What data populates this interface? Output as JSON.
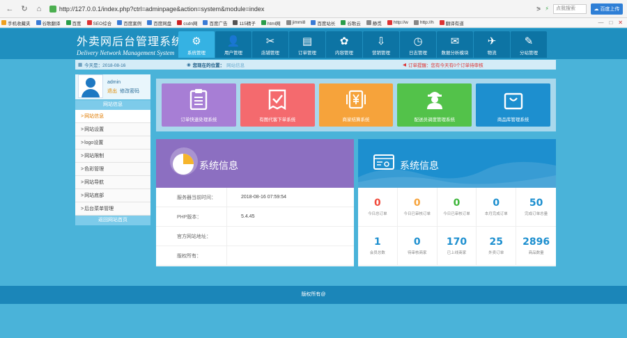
{
  "browser": {
    "url": "http://127.0.0.1/index.php?ctrl=adminpage&action=system&module=index",
    "search_placeholder": "点我搜索",
    "cloud_label": "百度上传"
  },
  "bookmarks": [
    "手机收藏夹",
    "谷歌翻译",
    "百度",
    "SEO综合",
    "百度案例",
    "百度网盘",
    "csdn网",
    "百度广告",
    "115精子",
    "html网",
    "jimmi8",
    "百度站长",
    "谷歌云",
    "静觅",
    "http://w",
    "http://h",
    "翻译有道"
  ],
  "app": {
    "brand_cn": "外卖网后台管理系统",
    "brand_en": "Delivery Network Management System",
    "nav": [
      {
        "label": "系统管理",
        "icon": "gear-icon",
        "glyph": "⚙",
        "active": true
      },
      {
        "label": "用户管理",
        "icon": "user-icon",
        "glyph": "👤",
        "active": false
      },
      {
        "label": "店铺管理",
        "icon": "tools-icon",
        "glyph": "✂",
        "active": false
      },
      {
        "label": "订单管理",
        "icon": "order-icon",
        "glyph": "▤",
        "active": false
      },
      {
        "label": "内容管理",
        "icon": "film-icon",
        "glyph": "✿",
        "active": false
      },
      {
        "label": "营销管理",
        "icon": "marketing-icon",
        "glyph": "⇩",
        "active": false
      },
      {
        "label": "日志管理",
        "icon": "clock-icon",
        "glyph": "◷",
        "active": false
      },
      {
        "label": "数据分析模块",
        "icon": "mail-icon",
        "glyph": "✉",
        "active": false
      },
      {
        "label": "物流",
        "icon": "plane-icon",
        "glyph": "✈",
        "active": false
      },
      {
        "label": "分站管理",
        "icon": "wrench-icon",
        "glyph": "✎",
        "active": false
      }
    ]
  },
  "infobar": {
    "today_label": "今天是：2018-08-16",
    "location_label": "您现在的位置：",
    "location_value": "网站信息",
    "order_alert": "订单提醒：您有今天有0个订单待审核"
  },
  "sidebar": {
    "username": "admin",
    "logout": "退出",
    "change_pwd": "修改密码",
    "section_title": "网站信息",
    "items": [
      {
        "label": "网站信息",
        "active": true
      },
      {
        "label": "网站设置",
        "active": false
      },
      {
        "label": "logo设置",
        "active": false
      },
      {
        "label": "网站限制",
        "active": false
      },
      {
        "label": "色彩管理",
        "active": false
      },
      {
        "label": "网站导航",
        "active": false
      },
      {
        "label": "网站底部",
        "active": false
      },
      {
        "label": "后台菜单管理",
        "active": false
      }
    ],
    "back_home": "返回网站首页"
  },
  "tiles": [
    {
      "label": "订单快速处理系统",
      "color": "#a77ed5",
      "icon": "document-icon"
    },
    {
      "label": "有图代客下单系统",
      "color": "#f46a6e",
      "icon": "checklist-icon"
    },
    {
      "label": "商家结算系统",
      "color": "#f6a33b",
      "icon": "yen-icon"
    },
    {
      "label": "配送员调度管理系统",
      "color": "#53c24a",
      "icon": "courier-icon"
    },
    {
      "label": "商品库管理系统",
      "color": "#1d8fcf",
      "icon": "bag-icon"
    }
  ],
  "system_info": {
    "title": "系统信息",
    "rows": [
      {
        "key": "服务器当前时间：",
        "value": "2018-08-16 07:59:54"
      },
      {
        "key": "PHP版本：",
        "value": "5.4.45"
      },
      {
        "key": "官方网站地址：",
        "value": ""
      },
      {
        "key": "版权所有：",
        "value": ""
      }
    ]
  },
  "stats": {
    "title": "系统信息",
    "items": [
      {
        "value": "0",
        "label": "今日总订单",
        "color": "#f04b3c"
      },
      {
        "value": "0",
        "label": "今日已审核订单",
        "color": "#f6a33b"
      },
      {
        "value": "0",
        "label": "今日已审核订单",
        "color": "#3fb63c"
      },
      {
        "value": "0",
        "label": "本月完成订单",
        "color": "#1d8fcf"
      },
      {
        "value": "50",
        "label": "完成订单总量",
        "color": "#1d8fcf"
      },
      {
        "value": "1",
        "label": "会员总数",
        "color": "#1d8fcf"
      },
      {
        "value": "0",
        "label": "待审核商家",
        "color": "#1d8fcf"
      },
      {
        "value": "170",
        "label": "已上线商家",
        "color": "#1d8fcf"
      },
      {
        "value": "25",
        "label": "外卖订单",
        "color": "#1d8fcf"
      },
      {
        "value": "2896",
        "label": "商品数量",
        "color": "#1d8fcf"
      }
    ]
  },
  "footer": {
    "text": "版权所有@"
  }
}
